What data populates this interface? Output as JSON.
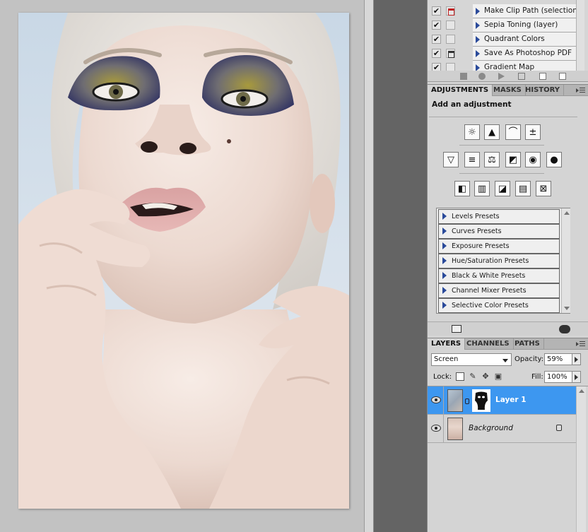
{
  "actions": {
    "items": [
      {
        "label": "Make Clip Path (selection)",
        "checked": true,
        "dialog": "red"
      },
      {
        "label": "Sepia Toning (layer)",
        "checked": true,
        "dialog": "none"
      },
      {
        "label": "Quadrant Colors",
        "checked": true,
        "dialog": "none"
      },
      {
        "label": "Save As Photoshop PDF",
        "checked": true,
        "dialog": "dark"
      },
      {
        "label": "Gradient Map",
        "checked": true,
        "dialog": "none"
      }
    ],
    "check_glyph": "✔",
    "toolbar_icons": [
      "stop-icon",
      "record-icon",
      "play-icon",
      "new-set-icon",
      "new-action-icon",
      "trash-icon"
    ]
  },
  "adjustments_panel": {
    "tabs": [
      "ADJUSTMENTS",
      "MASKS",
      "HISTORY"
    ],
    "heading": "Add an adjustment",
    "icon_rows": [
      [
        {
          "name": "brightness-contrast-icon",
          "glyph": "☼"
        },
        {
          "name": "levels-icon",
          "glyph": "▲"
        },
        {
          "name": "curves-icon",
          "glyph": "⌒"
        },
        {
          "name": "exposure-icon",
          "glyph": "±"
        }
      ],
      [
        {
          "name": "vibrance-icon",
          "glyph": "▽"
        },
        {
          "name": "hue-saturation-icon",
          "glyph": "≡"
        },
        {
          "name": "color-balance-icon",
          "glyph": "⚖"
        },
        {
          "name": "black-white-icon",
          "glyph": "◩"
        },
        {
          "name": "photo-filter-icon",
          "glyph": "◉"
        },
        {
          "name": "channel-mixer-icon",
          "glyph": "●"
        }
      ],
      [
        {
          "name": "invert-icon",
          "glyph": "◧"
        },
        {
          "name": "posterize-icon",
          "glyph": "▥"
        },
        {
          "name": "threshold-icon",
          "glyph": "◪"
        },
        {
          "name": "gradient-map-icon",
          "glyph": "▤"
        },
        {
          "name": "selective-color-icon",
          "glyph": "⊠"
        }
      ]
    ],
    "presets": [
      "Levels Presets",
      "Curves Presets",
      "Exposure Presets",
      "Hue/Saturation Presets",
      "Black & White Presets",
      "Channel Mixer Presets",
      "Selective Color Presets"
    ]
  },
  "layers_panel": {
    "tabs": [
      "LAYERS",
      "CHANNELS",
      "PATHS"
    ],
    "blend_mode": "Screen",
    "opacity_label": "Opacity:",
    "opacity_value": "59%",
    "lock_label": "Lock:",
    "fill_label": "Fill:",
    "fill_value": "100%",
    "layers": [
      {
        "name": "Layer 1",
        "selected": true
      },
      {
        "name": "Background",
        "selected": false
      }
    ]
  },
  "colors": {
    "selection": "#3d97f0",
    "panel_bg": "#d4d4d4",
    "dock_gap": "#646464",
    "preset_arrow": "#2a4a9a"
  }
}
